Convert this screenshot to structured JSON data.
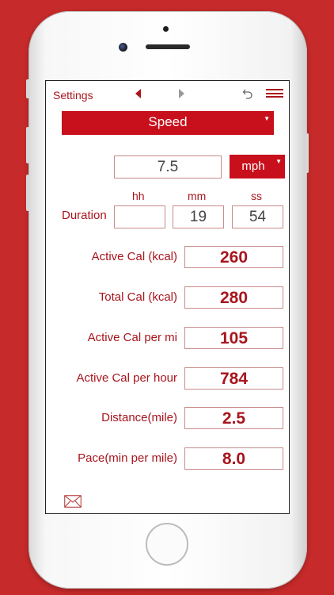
{
  "toolbar": {
    "settings_label": "Settings",
    "icons": [
      "chevron-left-icon",
      "chevron-right-icon",
      "undo-icon",
      "menu-icon"
    ]
  },
  "mode_select": {
    "selected": "Speed"
  },
  "speed": {
    "value": "7.5",
    "unit": "mph"
  },
  "duration": {
    "label": "Duration",
    "headers": {
      "hh": "hh",
      "mm": "mm",
      "ss": "ss"
    },
    "values": {
      "hh": "",
      "mm": "19",
      "ss": "54"
    }
  },
  "results": [
    {
      "label": "Active Cal (kcal)",
      "value": "260"
    },
    {
      "label": "Total Cal (kcal)",
      "value": "280"
    },
    {
      "label": "Active Cal per mi",
      "value": "105"
    },
    {
      "label": "Active Cal per hour",
      "value": "784"
    },
    {
      "label": "Distance(mile)",
      "value": "2.5"
    },
    {
      "label": "Pace(min per mile)",
      "value": "8.0"
    }
  ],
  "footer": {
    "icon": "mail-icon"
  },
  "colors": {
    "accent": "#c8101c",
    "text": "#a8151d",
    "background": "#c62a2a"
  }
}
